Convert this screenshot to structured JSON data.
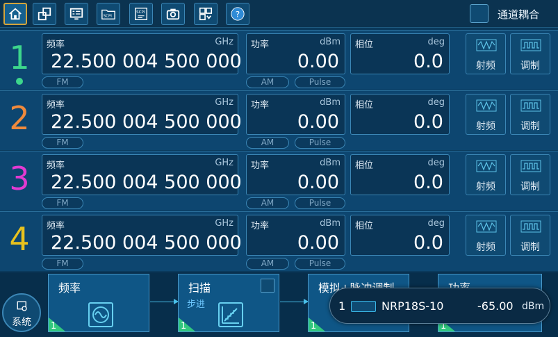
{
  "toolbar": {
    "icons": [
      "home-icon",
      "window-layers-icon",
      "monitor-list-icon",
      "scpi-folder-icon",
      "scpi-script-icon",
      "camera-icon",
      "layout-grid-icon",
      "help-icon"
    ],
    "help_glyph": "?",
    "couple_label": "通道耦合"
  },
  "labels": {
    "freq": "频率",
    "freq_unit": "GHz",
    "power": "功率",
    "power_unit": "dBm",
    "phase": "相位",
    "phase_unit": "deg",
    "fm": "FM",
    "am": "AM",
    "pulse": "Pulse",
    "rf": "射频",
    "mod": "调制"
  },
  "channels": [
    {
      "num": "1",
      "color": "#3dd68c",
      "freq": "22.500 004 500 000",
      "power": "0.00",
      "phase": "0.0"
    },
    {
      "num": "2",
      "color": "#f08a3c",
      "freq": "22.500 004 500 000",
      "power": "0.00",
      "phase": "0.0"
    },
    {
      "num": "3",
      "color": "#e23ad2",
      "freq": "22.500 004 500 000",
      "power": "0.00",
      "phase": "0.0"
    },
    {
      "num": "4",
      "color": "#e8c21e",
      "freq": "22.500 004 500 000",
      "power": "0.00",
      "phase": "0.0"
    }
  ],
  "bottom": {
    "system_label": "系统",
    "blocks": [
      {
        "title": "频率",
        "sub": "",
        "num": "1"
      },
      {
        "title": "扫描",
        "sub": "步进",
        "num": "1"
      },
      {
        "title": "模拟+脉冲调制",
        "sub": "",
        "num": "1"
      },
      {
        "title": "功率",
        "sub": "",
        "num": "1"
      }
    ]
  },
  "sensor": {
    "index": "1",
    "name": "NRP18S-10",
    "value": "-65.00",
    "unit": "dBm"
  }
}
